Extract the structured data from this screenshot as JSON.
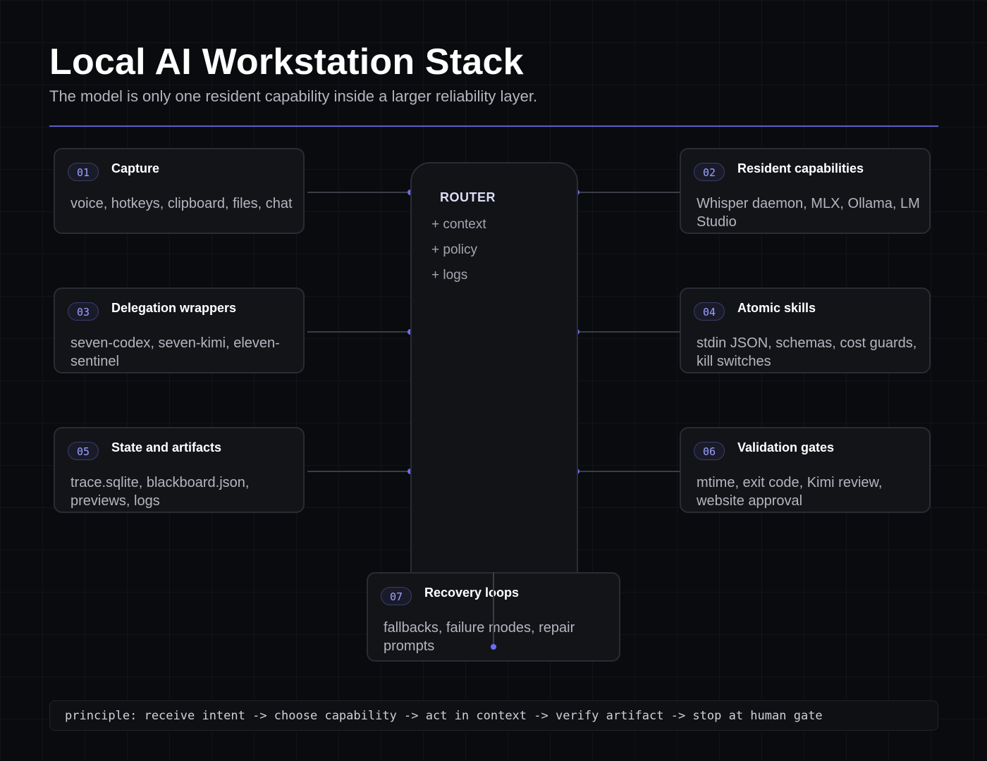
{
  "header": {
    "title": "Local AI Workstation Stack",
    "subtitle": "The model is only one resident capability inside a larger reliability layer."
  },
  "router": {
    "title": "ROUTER",
    "items": [
      "+ context",
      "+ policy",
      "+ logs"
    ]
  },
  "cards": [
    {
      "num": "01",
      "title": "Capture",
      "body": "voice, hotkeys, clipboard, files, chat"
    },
    {
      "num": "02",
      "title": "Resident capabilities",
      "body": "Whisper daemon, MLX, Ollama, LM Studio"
    },
    {
      "num": "03",
      "title": "Delegation wrappers",
      "body": "seven-codex, seven-kimi, eleven-sentinel"
    },
    {
      "num": "04",
      "title": "Atomic skills",
      "body": "stdin JSON, schemas, cost guards, kill switches"
    },
    {
      "num": "05",
      "title": "State and artifacts",
      "body": "trace.sqlite, blackboard.json, previews, logs"
    },
    {
      "num": "06",
      "title": "Validation gates",
      "body": "mtime, exit code, Kimi review, website approval"
    },
    {
      "num": "07",
      "title": "Recovery loops",
      "body": "fallbacks, failure modes, repair prompts"
    }
  ],
  "footer": {
    "principle": "principle: receive intent -> choose capability -> act in context -> verify artifact -> stop at human gate"
  },
  "colors": {
    "accent": "#6b6ef5",
    "background": "#0a0b0e",
    "card": "#131418"
  }
}
